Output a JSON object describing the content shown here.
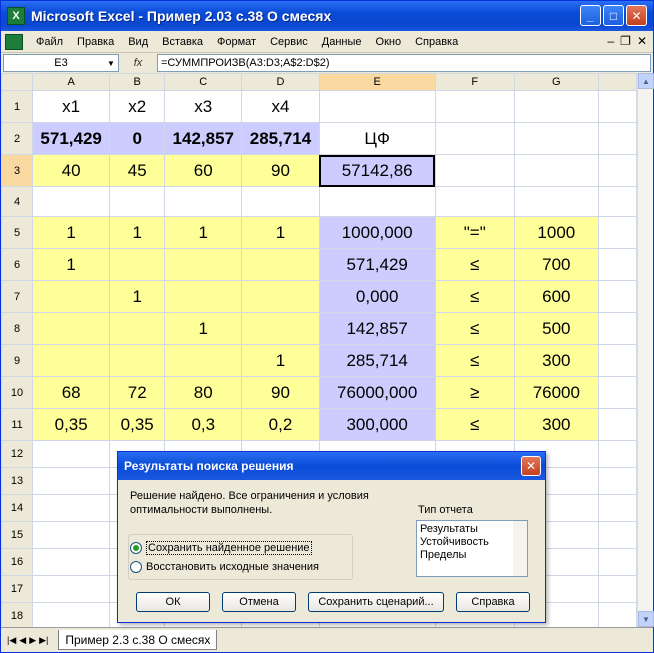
{
  "window": {
    "title": "Microsoft Excel - Пример 2.03 с.38 О смесях"
  },
  "menu": {
    "items": [
      "Файл",
      "Правка",
      "Вид",
      "Вставка",
      "Формат",
      "Сервис",
      "Данные",
      "Окно",
      "Справка"
    ]
  },
  "formula_bar": {
    "name_box": "E3",
    "fx_label": "fx",
    "formula": "=СУММПРОИЗВ(A3:D3;A$2:D$2)"
  },
  "sheet": {
    "columns": [
      "A",
      "B",
      "C",
      "D",
      "E",
      "F",
      "G"
    ],
    "rows": [
      {
        "n": "1",
        "cells": [
          "x1",
          "x2",
          "x3",
          "x4",
          "",
          "",
          ""
        ]
      },
      {
        "n": "2",
        "cells": [
          "571,429",
          "0",
          "142,857",
          "285,714",
          "ЦФ",
          "",
          ""
        ]
      },
      {
        "n": "3",
        "cells": [
          "40",
          "45",
          "60",
          "90",
          "57142,86",
          "",
          ""
        ]
      },
      {
        "n": "4",
        "cells": [
          "",
          "",
          "",
          "",
          "",
          "",
          ""
        ]
      },
      {
        "n": "5",
        "cells": [
          "1",
          "1",
          "1",
          "1",
          "1000,000",
          "\"=\"",
          "1000"
        ]
      },
      {
        "n": "6",
        "cells": [
          "1",
          "",
          "",
          "",
          "571,429",
          "≤",
          "700"
        ]
      },
      {
        "n": "7",
        "cells": [
          "",
          "1",
          "",
          "",
          "0,000",
          "≤",
          "600"
        ]
      },
      {
        "n": "8",
        "cells": [
          "",
          "",
          "1",
          "",
          "142,857",
          "≤",
          "500"
        ]
      },
      {
        "n": "9",
        "cells": [
          "",
          "",
          "",
          "1",
          "285,714",
          "≤",
          "300"
        ]
      },
      {
        "n": "10",
        "cells": [
          "68",
          "72",
          "80",
          "90",
          "76000,000",
          "≥",
          "76000"
        ]
      },
      {
        "n": "11",
        "cells": [
          "0,35",
          "0,35",
          "0,3",
          "0,2",
          "300,000",
          "≤",
          "300"
        ]
      },
      {
        "n": "12",
        "cells": [
          "",
          "",
          "",
          "",
          "",
          "",
          ""
        ]
      },
      {
        "n": "13",
        "cells": [
          "",
          "",
          "",
          "",
          "",
          "",
          ""
        ]
      },
      {
        "n": "14",
        "cells": [
          "",
          "",
          "",
          "",
          "",
          "",
          ""
        ]
      },
      {
        "n": "15",
        "cells": [
          "",
          "",
          "",
          "",
          "",
          "",
          ""
        ]
      },
      {
        "n": "16",
        "cells": [
          "",
          "",
          "",
          "",
          "",
          "",
          ""
        ]
      },
      {
        "n": "17",
        "cells": [
          "",
          "",
          "",
          "",
          "",
          "",
          ""
        ]
      },
      {
        "n": "18",
        "cells": [
          "",
          "",
          "",
          "",
          "",
          "",
          ""
        ]
      }
    ],
    "tab_name": "Пример 2.3 с.38 О смесях"
  },
  "dialog": {
    "title": "Результаты поиска решения",
    "message": "Решение найдено. Все ограничения и условия оптимальности выполнены.",
    "report_label": "Тип отчета",
    "report_items": [
      "Результаты",
      "Устойчивость",
      "Пределы"
    ],
    "options": [
      "Сохранить найденное решение",
      "Восстановить исходные значения"
    ],
    "buttons": {
      "ok": "ОК",
      "cancel": "Отмена",
      "save_scenario": "Сохранить сценарий...",
      "help": "Справка"
    }
  },
  "colors": {
    "yellow_fill": "#ffff99",
    "lavender_fill": "#ccccff",
    "xp_blue": "#0a4bd6"
  }
}
